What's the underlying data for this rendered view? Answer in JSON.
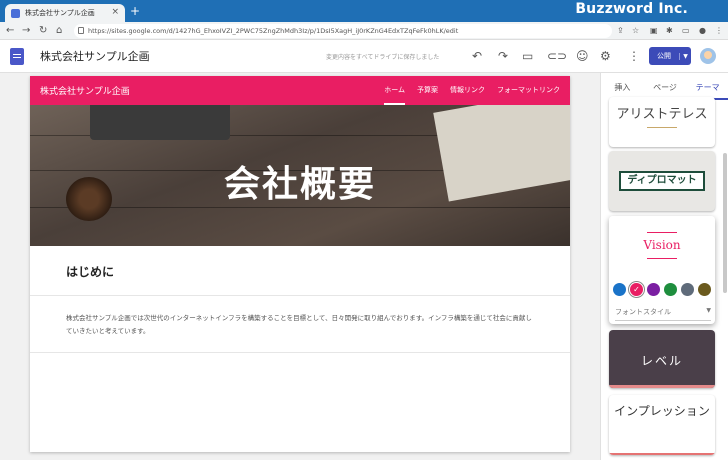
{
  "browser": {
    "tab_title": "株式会社サンプル企画",
    "url": "https://sites.google.com/d/1427hG_EhxoIVZI_2PWC75ZngZhMdh3Iz/p/1DsI5XagH_iJ0rKZnG4EdxTZqFeFk0hLK/edit",
    "brand": "Buzzword Inc."
  },
  "editor": {
    "site_title": "株式会社サンプル企画",
    "save_status": "変更内容をすべてドライブに保存しました",
    "publish_label": "公開"
  },
  "site": {
    "nav_name": "株式会社サンプル企画",
    "nav_links": [
      "ホーム",
      "予算案",
      "情報リンク",
      "フォーマットリンク"
    ],
    "hero_title": "会社概要",
    "intro_heading": "はじめに",
    "intro_text": "株式会社サンプル企画では次世代のインターネットインフラを構築することを目標として、日々開発に取り組んでおります。インフラ構築を通じて社会に貢献していきたいと考えています。"
  },
  "panel": {
    "tabs": [
      "挿入",
      "ページ",
      "テーマ"
    ],
    "themes": [
      "アリストテレス",
      "ディプロマット",
      "Vision",
      "レベル",
      "インプレッション"
    ],
    "font_style_label": "フォントスタイル",
    "swatch_colors": [
      "#1a73c8",
      "#e91e63",
      "#7b1fa2",
      "#1e8e3e",
      "#5f6b7a",
      "#6b5a1e"
    ]
  }
}
